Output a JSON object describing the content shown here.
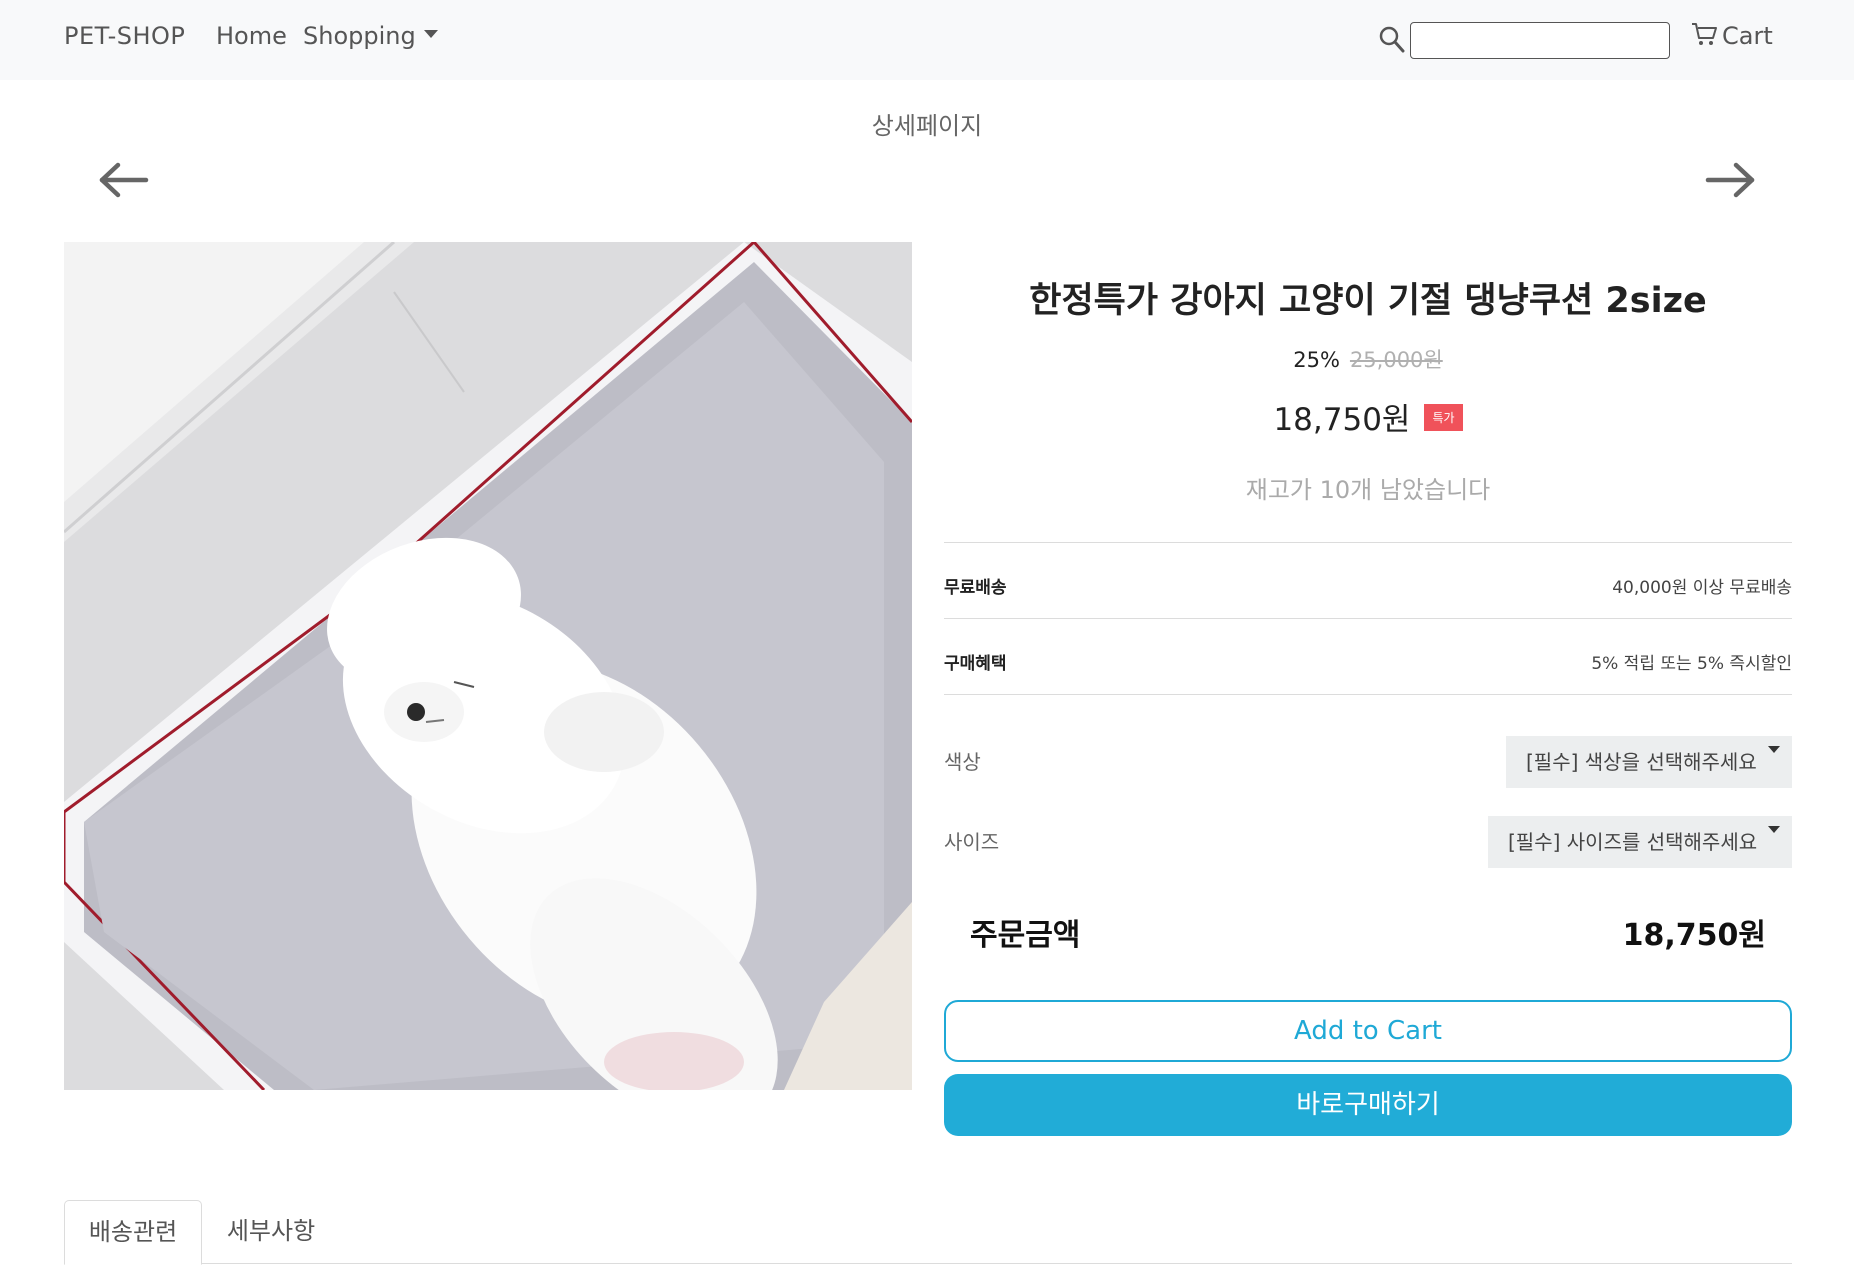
{
  "navbar": {
    "brand": "PET-SHOP",
    "home": "Home",
    "shopping": "Shopping",
    "search_placeholder": "",
    "cart": "Cart"
  },
  "page": {
    "heading": "상세페이지"
  },
  "product": {
    "title": "한정특가 강아지 고양이 기절 댕냥쿠션 2size",
    "discount": "25%",
    "original_price": "25,000원",
    "price": "18,750원",
    "badge": "특가",
    "stock": "재고가 10개 남았습니다",
    "image_alt": "white puppy sleeping on a grey cushion"
  },
  "info": {
    "shipping_label": "무료배송",
    "shipping_value": "40,000원 이상 무료배송",
    "benefit_label": "구매혜택",
    "benefit_value": "5% 적립 또는 5% 즉시할인"
  },
  "options": {
    "color_label": "색상",
    "color_selected": "[필수] 색상을 선택해주세요",
    "size_label": "사이즈",
    "size_selected": "[필수] 사이즈를 선택해주세요"
  },
  "order": {
    "total_label": "주문금액",
    "total_value": "18,750원"
  },
  "buttons": {
    "add_to_cart": "Add to Cart",
    "buy_now": "바로구매하기"
  },
  "tabs": {
    "shipping": "배송관련",
    "detail": "세부사항"
  },
  "colors": {
    "accent": "#21acd7",
    "badge": "#f0525a",
    "navbar_bg": "#f8f9fa"
  },
  "icons": {
    "search": "search-icon",
    "cart": "cart-icon",
    "prev": "arrow-left-icon",
    "next": "arrow-right-icon"
  }
}
